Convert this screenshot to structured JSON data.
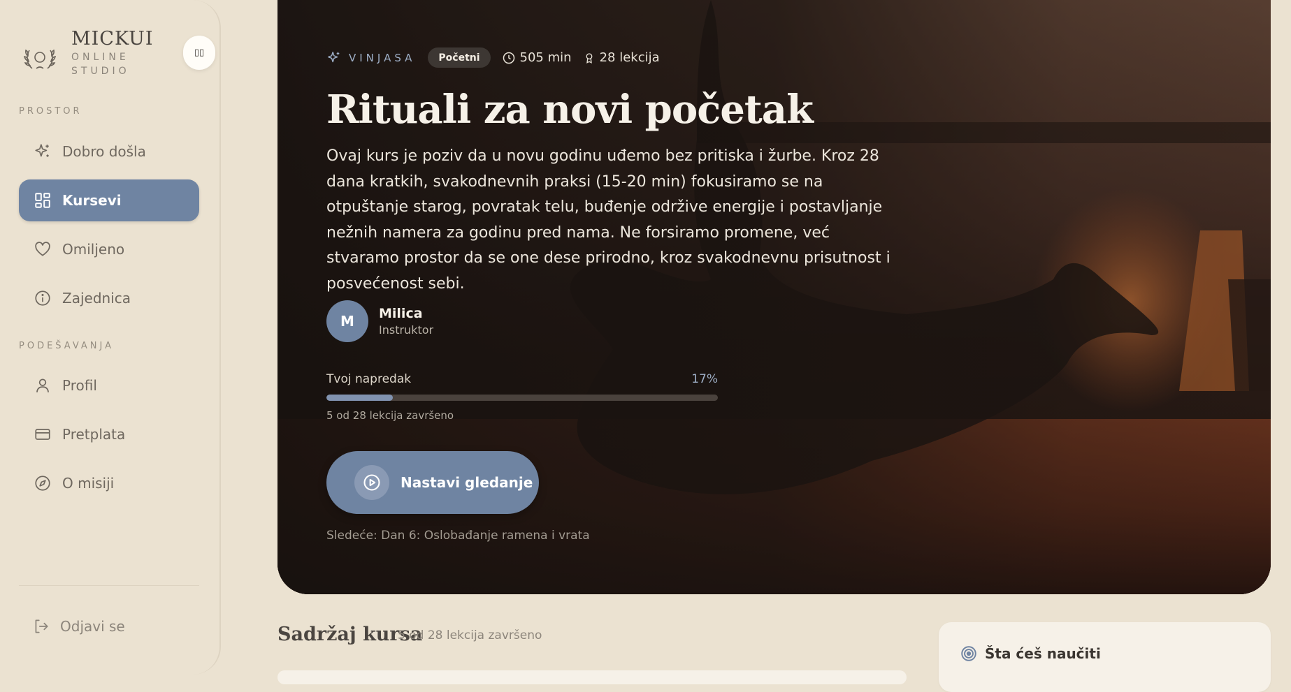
{
  "brand": {
    "name": "MICKUI",
    "sub_line1": "ONLINE",
    "sub_line2": "STUDIO"
  },
  "sidebar": {
    "collapse_label": "▯▯",
    "section_space": "PROSTOR",
    "section_settings": "PODEŠAVANJA",
    "items": [
      {
        "label": "Dobro došla",
        "icon": "sparkle-icon",
        "active": false
      },
      {
        "label": "Kursevi",
        "icon": "grid-icon",
        "active": true
      },
      {
        "label": "Omiljeno",
        "icon": "heart-icon",
        "active": false
      },
      {
        "label": "Zajednica",
        "icon": "info-icon",
        "active": false
      },
      {
        "label": "Profil",
        "icon": "user-icon",
        "active": false
      },
      {
        "label": "Pretplata",
        "icon": "credit-card-icon",
        "active": false
      },
      {
        "label": "O misiji",
        "icon": "compass-icon",
        "active": false
      }
    ],
    "logout_label": "Odjavi se"
  },
  "course": {
    "category": "VINJASA",
    "level": "Početni",
    "duration": "505 min",
    "lessons": "28 lekcija",
    "title": "Rituali za novi početak",
    "description": "Ovaj kurs je poziv da u novu godinu uđemo bez pritiska i žurbe. Kroz 28 dana kratkih, svakodnevnih praksi (15-20 min) fokusiramo se na otpuštanje starog, povratak telu, buđenje održive energije i postavljanje nežnih namera za godinu pred nama. Ne forsiramo promene, već stvaramo prostor da se one dese prirodno, kroz svakodnevnu prisutnost i posvećenost sebi.",
    "instructor": {
      "initial": "M",
      "name": "Milica",
      "role": "Instruktor"
    },
    "progress": {
      "label": "Tvoj napredak",
      "percent_text": "17%",
      "fraction": 0.17,
      "sub": "5 od 28 lekcija završeno"
    },
    "cta_label": "Nastavi gledanje",
    "next_up": "Sledeće: Dan 6: Oslobađanje ramena i vrata"
  },
  "content_section": {
    "title": "Sadržaj kursa",
    "sub": "5 od 28 lekcija završeno"
  },
  "learn_card": {
    "title": "Šta ćeš naučiti"
  },
  "colors": {
    "accent": "#6f84a2",
    "background": "#ebe2d1",
    "card": "#f6f1e8"
  }
}
